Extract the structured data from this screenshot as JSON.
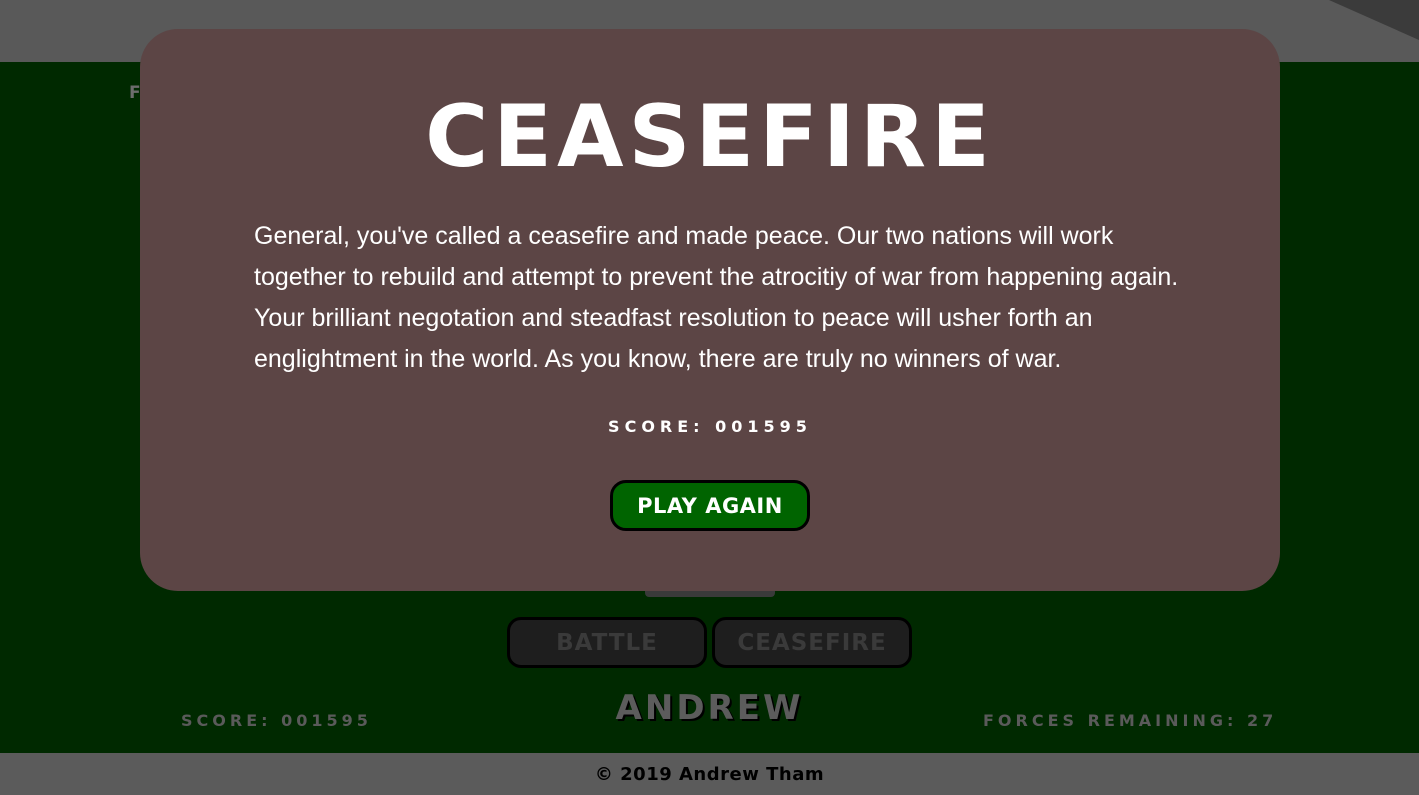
{
  "background": {
    "partial_label": "F",
    "battle_label": "BATTLE",
    "ceasefire_label": "CEASEFIRE",
    "player_name": "ANDREW",
    "score_text": "SCORE: 001595",
    "forces_text": "FORCES REMAINING: 27"
  },
  "footer": {
    "copyright": "© 2019 Andrew Tham"
  },
  "modal": {
    "title": "CEASEFIRE",
    "message": "General, you've called a ceasefire and made peace. Our two nations will work together to rebuild and attempt to prevent the atrocitiy of war from happening again. Your brilliant negotation and steadfast resolution to peace will usher forth an englightment in the world. As you know, there are truly no winners of war.",
    "score_text": "SCORE: 001595",
    "play_again_label": "PLAY AGAIN"
  },
  "colors": {
    "modal_bg": "#5c4545",
    "field_bg": "#002900",
    "play_button_bg": "#006400"
  }
}
